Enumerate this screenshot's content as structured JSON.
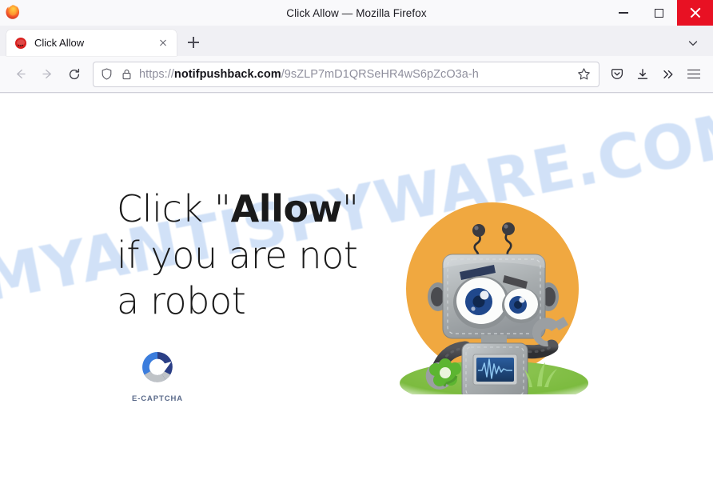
{
  "window": {
    "title": "Click Allow — Mozilla Firefox",
    "minimize_label": "Minimize",
    "maximize_label": "Maximize",
    "close_label": "Close",
    "close_button_color": "#e81123"
  },
  "tabs": {
    "items": [
      {
        "label": "Click Allow",
        "favicon": "red-circle-favicon",
        "close_label": "Close tab"
      }
    ],
    "new_tab_label": "New tab",
    "list_all_tabs_label": "List all tabs"
  },
  "navbar": {
    "back_label": "Go back one page",
    "forward_label": "Go forward one page",
    "reload_label": "Reload current page",
    "shield_label": "Enhanced Tracking Protection",
    "lock_label": "Connection secure",
    "url_scheme": "https://",
    "url_domain": "notifpushback.com",
    "url_path": "/9sZLP7mD1QRSeHR4wS6pZcO3a-h",
    "url_full": "https://notifpushback.com/9sZLP7mD1QRSeHR4wS6pZcO3a-h",
    "bookmark_label": "Bookmark this page",
    "pocket_label": "Save to Pocket",
    "downloads_label": "Downloads",
    "overflow_label": "More tools",
    "menu_label": "Open application menu"
  },
  "page": {
    "watermark": "MYANTISPYWARE.COM",
    "watermark_color": "#cfe0f7",
    "headline_prefix": "Click \"",
    "headline_emphasis": "Allow",
    "headline_suffix": "\" if you are not a robot",
    "headline_full": "Click \"Allow\" if you are not a robot",
    "captcha": {
      "logo_name": "e-captcha-c-logo",
      "label": "E-CAPTCHA",
      "colors": {
        "blue": "#3b7ddd",
        "navy": "#2b3f86",
        "gray": "#bfc3c7"
      }
    },
    "illustration": {
      "name": "cartoon-robot-illustration",
      "background_circle_color": "#f0a840",
      "grass_color": "#7cbb3f",
      "body_color": "#a8acae",
      "screen_color": "#1f4e86",
      "eye_iris_color": "#20488c"
    }
  }
}
